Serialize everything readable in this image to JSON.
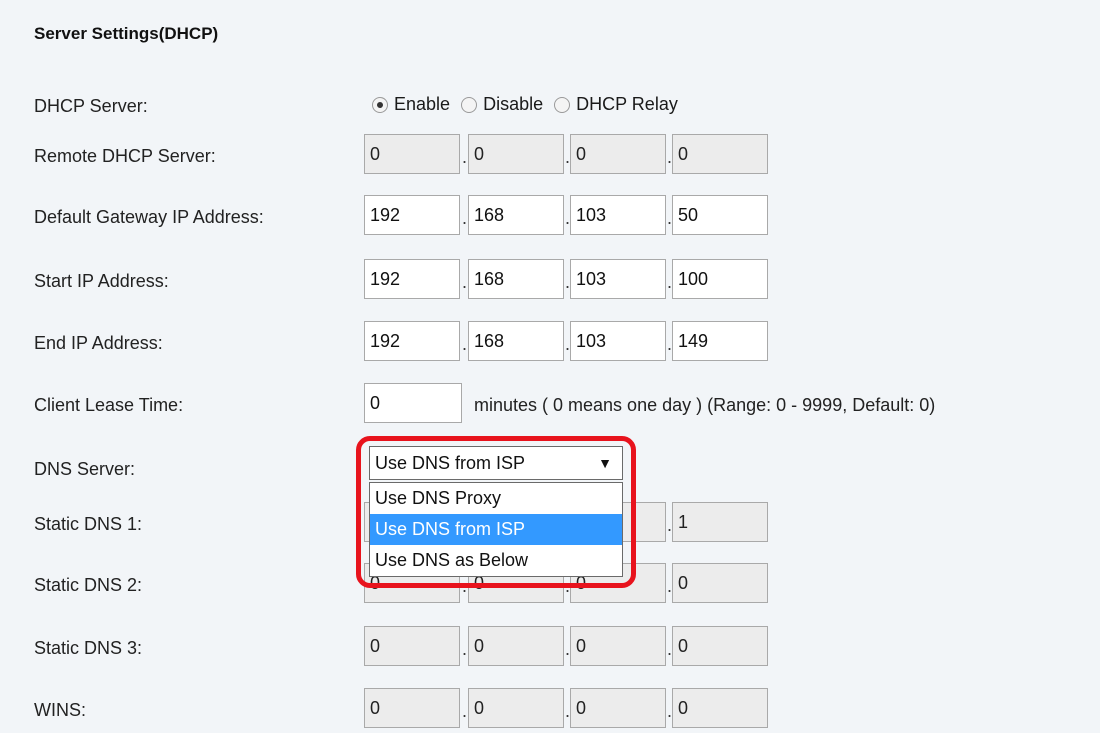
{
  "section_title": "Server Settings(DHCP)",
  "dhcp_server": {
    "label": "DHCP Server:",
    "options": [
      "Enable",
      "Disable",
      "DHCP Relay"
    ],
    "selected": "Enable"
  },
  "remote_dhcp": {
    "label": "Remote DHCP Server:",
    "octets": [
      "0",
      "0",
      "0",
      "0"
    ]
  },
  "default_gateway": {
    "label": "Default Gateway IP Address:",
    "octets": [
      "192",
      "168",
      "103",
      "50"
    ]
  },
  "start_ip": {
    "label": "Start IP Address:",
    "octets": [
      "192",
      "168",
      "103",
      "100"
    ]
  },
  "end_ip": {
    "label": "End IP Address:",
    "octets": [
      "192",
      "168",
      "103",
      "149"
    ]
  },
  "lease": {
    "label": "Client Lease Time:",
    "value": "0",
    "note": "minutes ( 0 means one day )  (Range: 0 - 9999, Default: 0)"
  },
  "dns_server": {
    "label": "DNS Server:",
    "selected": "Use DNS from ISP",
    "options": [
      "Use DNS Proxy",
      "Use DNS from ISP",
      "Use DNS as Below"
    ],
    "highlighted_index": 1
  },
  "static_dns1": {
    "label": "Static DNS 1:",
    "octets": [
      "",
      "",
      "",
      "1"
    ]
  },
  "static_dns2": {
    "label": "Static DNS 2:",
    "octets": [
      "0",
      "0",
      "0",
      "0"
    ]
  },
  "static_dns3": {
    "label": "Static DNS 3:",
    "octets": [
      "0",
      "0",
      "0",
      "0"
    ]
  },
  "wins": {
    "label": "WINS:",
    "octets": [
      "0",
      "0",
      "0",
      "0"
    ]
  },
  "colors": {
    "panel_bg": "#f2f5f8",
    "disabled_input_bg": "#ececec",
    "option_highlight": "#3399ff",
    "annotation_ring": "#e8131d"
  },
  "icons": {
    "dropdown_arrow": "caret-down-icon"
  }
}
